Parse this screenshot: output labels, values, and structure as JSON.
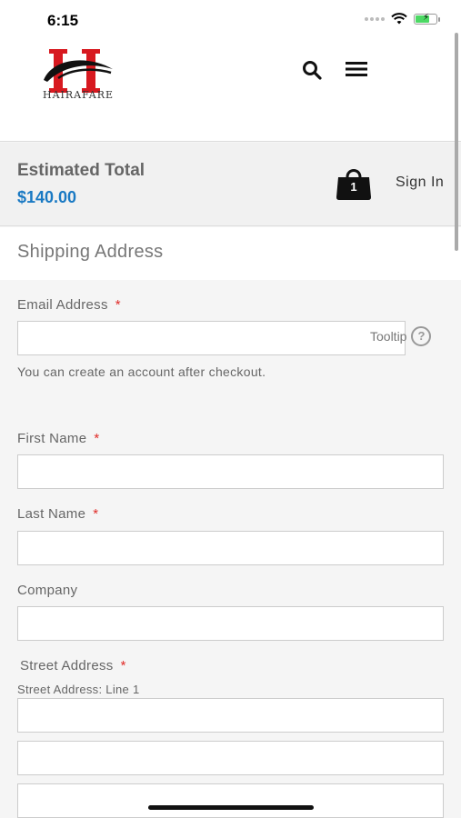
{
  "status_bar": {
    "time": "6:15"
  },
  "brand": {
    "logo_text": "HAIRAFARE"
  },
  "summary": {
    "estimated_total_label": "Estimated Total",
    "estimated_total_value": "$140.00",
    "cart_count": "1",
    "sign_in_label": "Sign In"
  },
  "shipping": {
    "title": "Shipping Address",
    "email_label": "Email Address",
    "required_mark": "*",
    "tooltip_label": "Tooltip",
    "tooltip_icon_text": "?",
    "email_note": "You can create an account after checkout.",
    "first_name_label": "First Name",
    "last_name_label": "Last Name",
    "company_label": "Company",
    "street_label": "Street Address",
    "street_line1_label": "Street Address: Line 1"
  },
  "colors": {
    "accent": "#1979c3",
    "required": "#e02b27",
    "logo_red": "#d71920"
  },
  "icons": [
    "search-icon",
    "hamburger-menu-icon",
    "shopping-bag-icon",
    "help-icon",
    "wifi-icon",
    "battery-icon"
  ]
}
